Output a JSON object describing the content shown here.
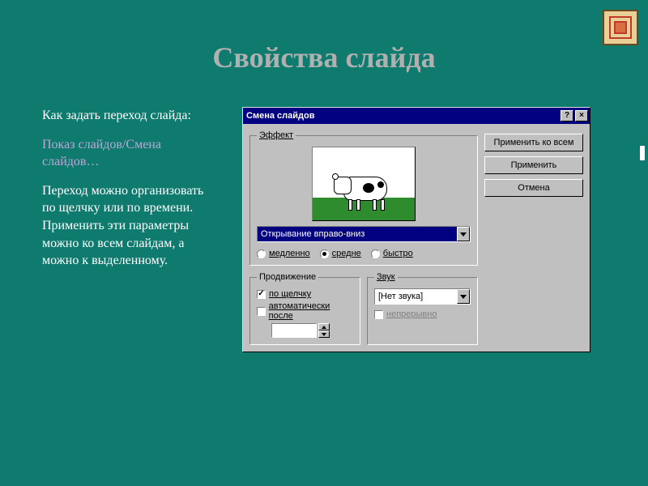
{
  "slide": {
    "title": "Свойства слайда",
    "intro": "Как задать переход слайда:",
    "menu_path": "Показ слайдов/Смена слайдов…",
    "desc": "Переход можно организовать по щелчку или по времени. Применить эти параметры можно ко всем слайдам, а можно к выделенному."
  },
  "dialog": {
    "title": "Смена слайдов",
    "help_btn": "?",
    "close_btn": "×",
    "groups": {
      "effect": "Эффект",
      "advance": "Продвижение",
      "sound": "Звук"
    },
    "effect": {
      "selected": "Открывание вправо-вниз",
      "speed": {
        "slow": "медленно",
        "medium": "средне",
        "fast": "быстро",
        "selected": "medium"
      }
    },
    "advance": {
      "on_click": "по щелчку",
      "auto_after": "автоматически после",
      "on_click_checked": true,
      "auto_after_checked": false,
      "time_value": ""
    },
    "sound": {
      "selected": "[Нет звука]",
      "loop": "непрерывно",
      "loop_checked": false,
      "loop_enabled": false
    },
    "buttons": {
      "apply_all": "Применить ко всем",
      "apply": "Применить",
      "cancel": "Отмена"
    }
  }
}
